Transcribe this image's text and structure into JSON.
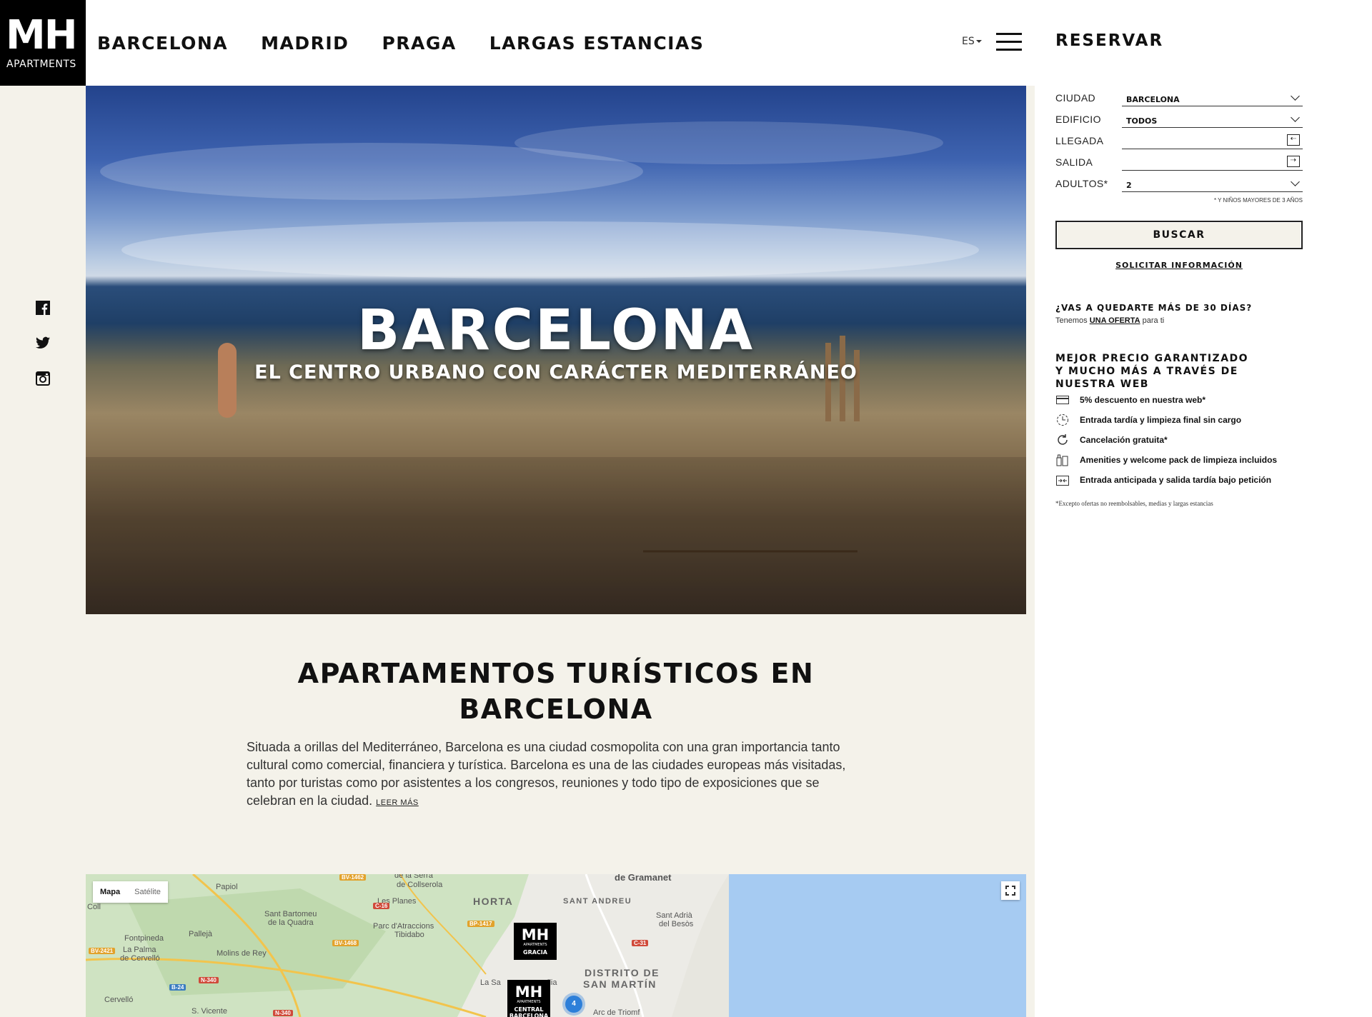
{
  "header": {
    "logo_main": "MH",
    "logo_sub": "APARTMENTS",
    "nav": [
      "BARCELONA",
      "MADRID",
      "PRAGA",
      "LARGAS ESTANCIAS"
    ],
    "lang": "ES",
    "reservar": "RESERVAR"
  },
  "booking": {
    "ciudad_label": "CIUDAD",
    "ciudad_value": "BARCELONA",
    "edificio_label": "EDIFICIO",
    "edificio_value": "TODOS",
    "llegada_label": "LLEGADA",
    "salida_label": "SALIDA",
    "adultos_label": "ADULTOS*",
    "adultos_value": "2",
    "ninos_note": "* Y NIÑOS MAYORES DE 3 AÑOS",
    "buscar": "BUSCAR",
    "solicitar": "SOLICITAR INFORMACIÓN",
    "stay_question": "¿VAS A QUEDARTE MÁS DE 30 DÍAS?",
    "tenemos_pre": "Tenemos",
    "oferta_link": "UNA OFERTA",
    "tenemos_post": "para ti",
    "mejor_line1": "MEJOR PRECIO GARANTIZADO",
    "mejor_line2": "Y MUCHO MÁS A TRAVÉS DE NUESTRA WEB",
    "benefits": [
      "5% descuento en nuestra web*",
      "Entrada tardía y limpieza final sin cargo",
      "Cancelación gratuita*",
      "Amenities y welcome pack de limpieza incluidos",
      "Entrada anticipada y salida tardía bajo petición"
    ],
    "excepto": "*Excepto ofertas no reembolsables, medias y largas estancias"
  },
  "social": [
    "facebook-icon",
    "twitter-icon",
    "instagram-icon"
  ],
  "hero": {
    "title": "BARCELONA",
    "subtitle": "EL CENTRO URBANO CON CARÁCTER MEDITERRÁNEO"
  },
  "content": {
    "title_line1": "APARTAMENTOS TURÍSTICOS EN",
    "title_line2": "BARCELONA",
    "paragraph": "Situada a orillas del Mediterráneo, Barcelona es una ciudad cosmopolita con una gran importancia tanto cultural como comercial, financiera y turística. Barcelona es una de las ciudades europeas más visitadas, tanto por turistas como por asistentes a los congresos, reuniones y todo tipo de exposiciones que se celebran en la ciudad.",
    "leer_mas": "LEER MÁS"
  },
  "map": {
    "mapa": "Mapa",
    "satelite": "Satélite",
    "labels": {
      "papiol": "Papiol",
      "coll": "Coll",
      "serra1": "de la Serra",
      "serra2": "de Collserola",
      "gramanet": "de Gramanet",
      "santbartomeu1": "Sant Bartomeu",
      "santbartomeu2": "de la Quadra",
      "lesplanes": "Les Planes",
      "parc1": "Parc d'Atraccions",
      "parc2": "Tibidabo",
      "fontpineda": "Fontpineda",
      "palleja": "Pallejà",
      "lapalma1": "La Palma",
      "lapalma2": "de Cervelló",
      "molins": "Molins de Rey",
      "cervello": "Cervelló",
      "svicente": "S. Vicente",
      "santadria1": "Sant Adrià",
      "santadria2": "del Besòs",
      "arc": "Arc de Triomf",
      "lasag": "La Sa",
      "llia": "llia"
    },
    "districts": {
      "horta": "HORTA",
      "santandreu": "SANT ANDREU",
      "distrito1": "DISTRITO DE",
      "distrito2": "SAN MARTÍN"
    },
    "roads": [
      "BV-1462",
      "C-16",
      "BP-1417",
      "BV-1468",
      "BV-2421",
      "N-340",
      "B-24",
      "N-340",
      "C-31"
    ],
    "pins": [
      {
        "name": "GRACIA"
      },
      {
        "name": "CENTRAL BARCELONA"
      }
    ],
    "cluster_count": "4"
  },
  "colors": {
    "background": "#f4f2ea",
    "black": "#000000",
    "map_sea": "#a6cbf2",
    "cluster": "#2d7fd9"
  }
}
